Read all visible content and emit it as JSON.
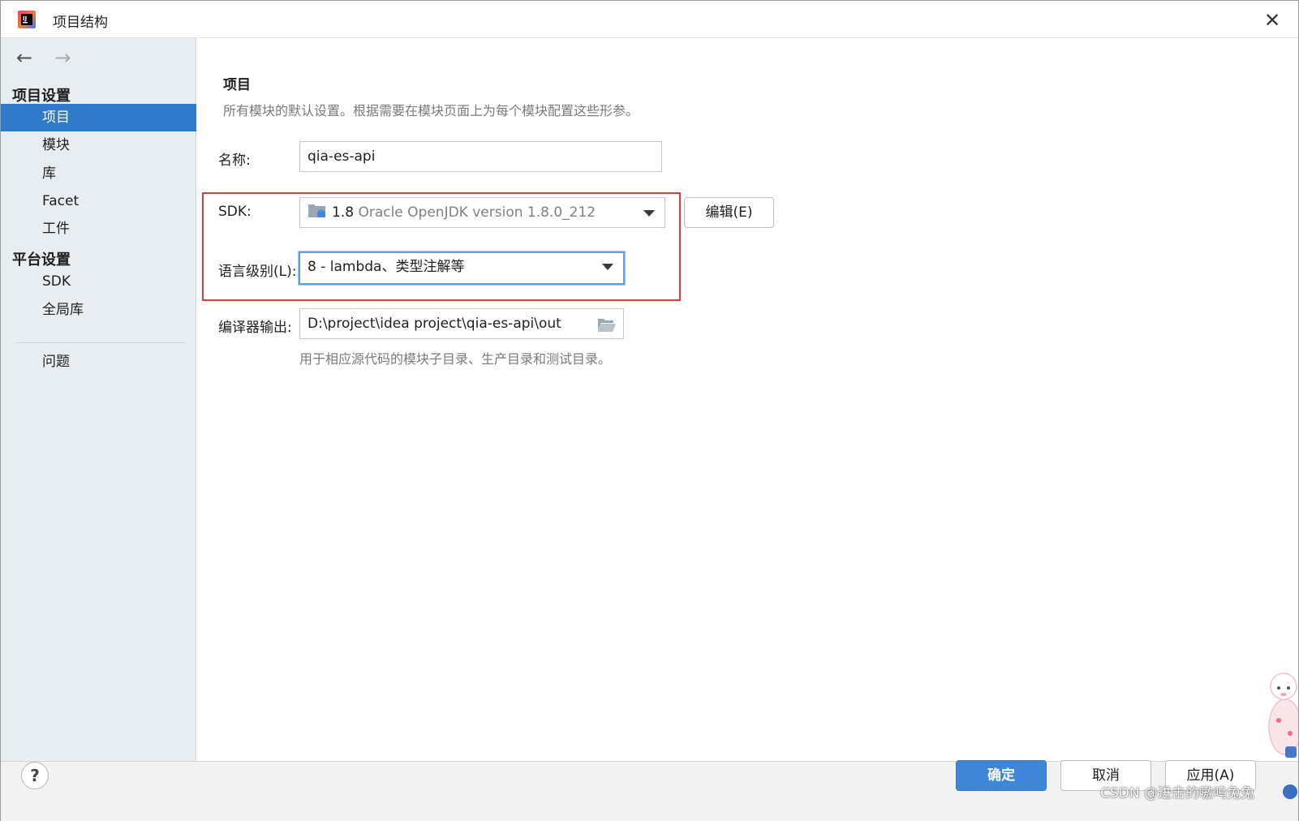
{
  "window": {
    "title": "项目结构",
    "close_glyph": "✕"
  },
  "sidebar": {
    "back_glyph": "←",
    "forward_glyph": "→",
    "project_settings_header": "项目设置",
    "project_items": [
      "项目",
      "模块",
      "库",
      "Facet",
      "工件"
    ],
    "platform_settings_header": "平台设置",
    "platform_items": [
      "SDK",
      "全局库"
    ],
    "problems_item": "问题",
    "selected_item": "项目"
  },
  "main": {
    "title": "项目",
    "description": "所有模块的默认设置。根据需要在模块页面上为每个模块配置这些形参。",
    "name_label": "名称:",
    "name_value": "qia-es-api",
    "sdk_label": "SDK:",
    "sdk_version": "1.8",
    "sdk_detail": "Oracle OpenJDK version 1.8.0_212",
    "edit_button": "编辑(E)",
    "language_level_label": "语言级别(L):",
    "language_level_value": "8 - lambda、类型注解等",
    "compiler_output_label": "编译器输出:",
    "compiler_output_value": "D:\\project\\idea project\\qia-es-api\\out",
    "compiler_output_hint": "用于相应源代码的模块子目录、生产目录和测试目录。"
  },
  "footer": {
    "help_glyph": "?",
    "ok_button": "确定",
    "cancel_button": "取消",
    "apply_button": "应用(A)",
    "watermark": "CSDN @进击的嗷呜兔兔"
  },
  "colors": {
    "selection": "#2e7ac8",
    "highlight_border": "#e0393e",
    "primary_button": "#3f86d8",
    "focus_ring": "#5f9ee3"
  },
  "icons": {
    "app": "intellij-idea-icon",
    "sdk": "sdk-folder-icon",
    "browse": "open-folder-icon"
  }
}
